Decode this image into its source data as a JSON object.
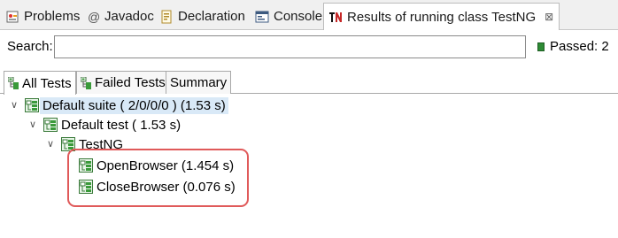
{
  "tabs": [
    {
      "label": "Problems",
      "icon": "problems-icon"
    },
    {
      "label": "Javadoc",
      "icon": "javadoc-icon"
    },
    {
      "label": "Declaration",
      "icon": "declaration-icon"
    },
    {
      "label": "Console",
      "icon": "console-icon"
    },
    {
      "label": "Results of running class TestNG",
      "icon": "testng-icon",
      "active": true,
      "close": "⊠"
    }
  ],
  "search": {
    "label": "Search:",
    "value": "",
    "placeholder": ""
  },
  "passed": {
    "label": "Passed: 2"
  },
  "subtabs": [
    {
      "label": "All Tests",
      "active": true
    },
    {
      "label": "Failed Tests"
    },
    {
      "label": "Summary"
    }
  ],
  "tree": {
    "suite": "Default suite ( 2/0/0/0 ) (1.53 s)",
    "test": "Default test ( 1.53 s)",
    "class": "TestNG",
    "methods": [
      "OpenBrowser  (1.454 s)",
      "CloseBrowser  (0.076 s)"
    ]
  },
  "colors": {
    "highlight": "#e05a5a",
    "selection": "#d9e9f7",
    "pass": "#2e8b35"
  }
}
